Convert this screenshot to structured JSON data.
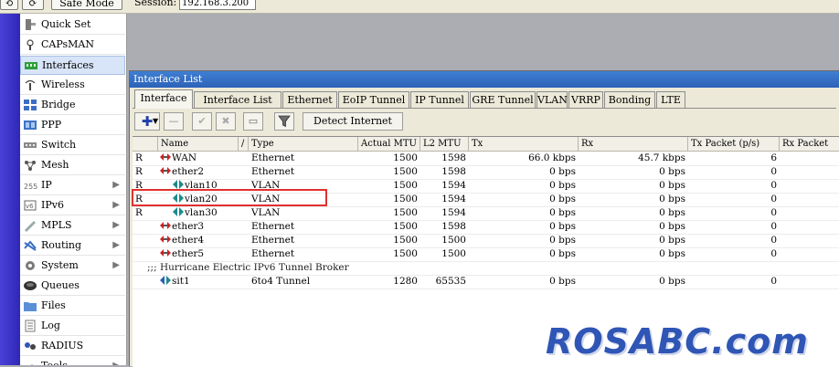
{
  "topbar": {
    "undo_icon": "undo-arrow-icon",
    "redo_icon": "redo-arrow-icon",
    "safe_mode_label": "Safe Mode",
    "session_label": "Session:",
    "session_value": "192.168.3.200"
  },
  "sidebar": {
    "items": [
      {
        "label": "Quick Set",
        "icon": "quick-set-icon",
        "submenu": false
      },
      {
        "label": "CAPsMAN",
        "icon": "capsman-icon",
        "submenu": false
      },
      {
        "label": "Interfaces",
        "icon": "interfaces-icon",
        "submenu": false,
        "active": true
      },
      {
        "label": "Wireless",
        "icon": "wireless-icon",
        "submenu": false
      },
      {
        "label": "Bridge",
        "icon": "bridge-icon",
        "submenu": false
      },
      {
        "label": "PPP",
        "icon": "ppp-icon",
        "submenu": false
      },
      {
        "label": "Switch",
        "icon": "switch-icon",
        "submenu": false
      },
      {
        "label": "Mesh",
        "icon": "mesh-icon",
        "submenu": false
      },
      {
        "label": "IP",
        "icon": "ip-icon",
        "submenu": true
      },
      {
        "label": "IPv6",
        "icon": "ipv6-icon",
        "submenu": true
      },
      {
        "label": "MPLS",
        "icon": "mpls-icon",
        "submenu": true
      },
      {
        "label": "Routing",
        "icon": "routing-icon",
        "submenu": true
      },
      {
        "label": "System",
        "icon": "system-icon",
        "submenu": true
      },
      {
        "label": "Queues",
        "icon": "queues-icon",
        "submenu": false
      },
      {
        "label": "Files",
        "icon": "files-icon",
        "submenu": false
      },
      {
        "label": "Log",
        "icon": "log-icon",
        "submenu": false
      },
      {
        "label": "RADIUS",
        "icon": "radius-icon",
        "submenu": false
      },
      {
        "label": "Tools",
        "icon": "tools-icon",
        "submenu": true
      }
    ],
    "submenu_glyph": "▶"
  },
  "window": {
    "title": "Interface List",
    "tabs": [
      "Interface",
      "Interface List",
      "Ethernet",
      "EoIP Tunnel",
      "IP Tunnel",
      "GRE Tunnel",
      "VLAN",
      "VRRP",
      "Bonding",
      "LTE"
    ],
    "active_tab": 0,
    "toolbar": {
      "add_glyph": "✚",
      "dropdown_glyph": "▼",
      "remove_glyph": "—",
      "enable_glyph": "✔",
      "disable_glyph": "✖",
      "comment_glyph": "▭",
      "filter_icon": "filter-icon",
      "detect_internet_label": "Detect Internet"
    },
    "columns": [
      "",
      "Name",
      "/",
      "Type",
      "Actual MTU",
      "L2 MTU",
      "Tx",
      "Rx",
      "Tx Packet (p/s)",
      "Rx Packet"
    ],
    "rows": [
      {
        "flag": "R",
        "name": "WAN",
        "indent": 0,
        "icon": "ethernet-icon",
        "type": "Ethernet",
        "mtu": "1500",
        "l2mtu": "1598",
        "tx": "66.0 kbps",
        "rx": "45.7 kbps",
        "txp": "6",
        "rxp": ""
      },
      {
        "flag": "R",
        "name": "ether2",
        "indent": 0,
        "icon": "ethernet-icon",
        "type": "Ethernet",
        "mtu": "1500",
        "l2mtu": "1598",
        "tx": "0 bps",
        "rx": "0 bps",
        "txp": "0",
        "rxp": ""
      },
      {
        "flag": "R",
        "name": "vlan10",
        "indent": 1,
        "icon": "vlan-icon",
        "type": "VLAN",
        "mtu": "1500",
        "l2mtu": "1594",
        "tx": "0 bps",
        "rx": "0 bps",
        "txp": "0",
        "rxp": ""
      },
      {
        "flag": "R",
        "name": "vlan20",
        "indent": 1,
        "icon": "vlan-icon",
        "type": "VLAN",
        "mtu": "1500",
        "l2mtu": "1594",
        "tx": "0 bps",
        "rx": "0 bps",
        "txp": "0",
        "rxp": "",
        "highlighted": true
      },
      {
        "flag": "R",
        "name": "vlan30",
        "indent": 1,
        "icon": "vlan-icon",
        "type": "VLAN",
        "mtu": "1500",
        "l2mtu": "1594",
        "tx": "0 bps",
        "rx": "0 bps",
        "txp": "0",
        "rxp": ""
      },
      {
        "flag": "",
        "name": "ether3",
        "indent": 0,
        "icon": "ethernet-icon",
        "type": "Ethernet",
        "mtu": "1500",
        "l2mtu": "1598",
        "tx": "0 bps",
        "rx": "0 bps",
        "txp": "0",
        "rxp": ""
      },
      {
        "flag": "",
        "name": "ether4",
        "indent": 0,
        "icon": "ethernet-icon",
        "type": "Ethernet",
        "mtu": "1500",
        "l2mtu": "1500",
        "tx": "0 bps",
        "rx": "0 bps",
        "txp": "0",
        "rxp": ""
      },
      {
        "flag": "",
        "name": "ether5",
        "indent": 0,
        "icon": "ethernet-icon",
        "type": "Ethernet",
        "mtu": "1500",
        "l2mtu": "1500",
        "tx": "0 bps",
        "rx": "0 bps",
        "txp": "0",
        "rxp": ""
      },
      {
        "comment": ";;; Hurricane Electric IPv6 Tunnel Broker"
      },
      {
        "flag": "",
        "name": "sit1",
        "indent": 0,
        "icon": "tunnel-icon",
        "type": "6to4 Tunnel",
        "mtu": "1280",
        "l2mtu": "65535",
        "tx": "0 bps",
        "rx": "0 bps",
        "txp": "0",
        "rxp": ""
      }
    ]
  },
  "colors": {
    "highlight": "#e0312e",
    "title_bar": "#2c62b8",
    "side_strip": "#3a32c8",
    "watermark": "#2f55b5"
  },
  "watermark": "ROSABC.com"
}
